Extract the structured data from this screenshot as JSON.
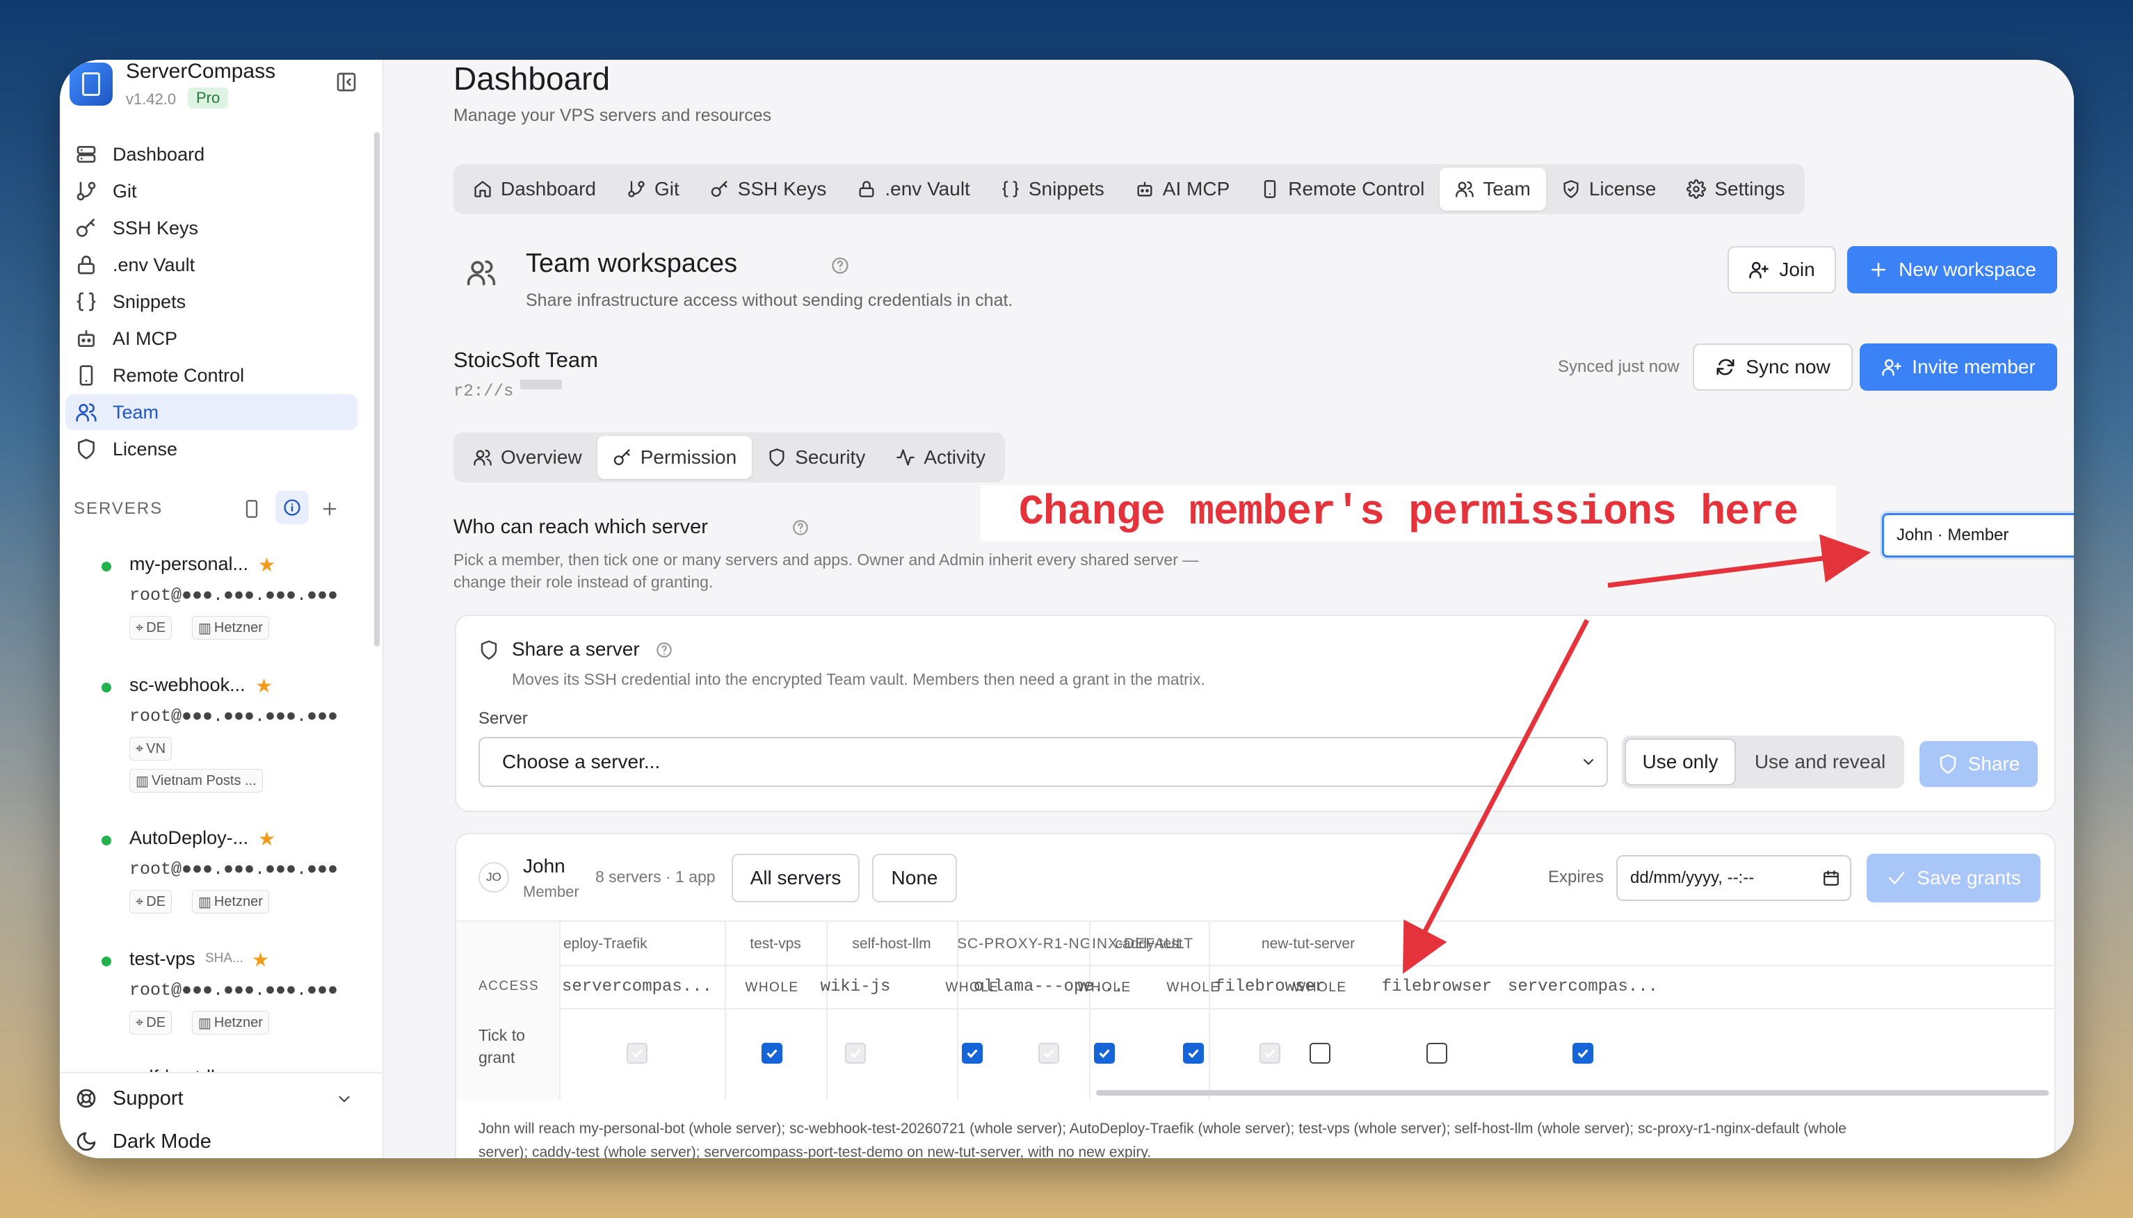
{
  "app": {
    "name": "ServerCompass",
    "version": "v1.42.0",
    "plan": "Pro"
  },
  "sidebar": {
    "nav": [
      {
        "label": "Dashboard",
        "icon": "server-stack-icon"
      },
      {
        "label": "Git",
        "icon": "git-branch-icon"
      },
      {
        "label": "SSH Keys",
        "icon": "key-icon"
      },
      {
        "label": ".env Vault",
        "icon": "lock-icon"
      },
      {
        "label": "Snippets",
        "icon": "braces-icon"
      },
      {
        "label": "AI MCP",
        "icon": "bot-icon"
      },
      {
        "label": "Remote Control",
        "icon": "phone-icon"
      },
      {
        "label": "Team",
        "icon": "users-icon"
      },
      {
        "label": "License",
        "icon": "shield-icon"
      }
    ],
    "servers_heading": "SERVERS",
    "servers": [
      {
        "name": "my-personal...",
        "host": "root@●●●.●●●.●●●.●●●",
        "tags": [
          "DE",
          "Hetzner"
        ]
      },
      {
        "name": "sc-webhook...",
        "host": "root@●●●.●●●.●●●.●●●",
        "tags": [
          "VN",
          "Vietnam Posts ..."
        ]
      },
      {
        "name": "AutoDeploy-...",
        "host": "root@●●●.●●●.●●●.●●●",
        "tags": [
          "DE",
          "Hetzner"
        ]
      },
      {
        "name": "test-vps",
        "badge": "SHA...",
        "host": "root@●●●.●●●.●●●.●●●",
        "tags": [
          "DE",
          "Hetzner"
        ]
      }
    ],
    "partial_server": "self-host-ll...",
    "support_label": "Support",
    "dark_mode_label": "Dark Mode"
  },
  "header": {
    "title": "Dashboard",
    "subtitle": "Manage your VPS servers and resources"
  },
  "tabs": [
    {
      "label": "Dashboard",
      "icon": "home-icon"
    },
    {
      "label": "Git",
      "icon": "git-branch-icon"
    },
    {
      "label": "SSH Keys",
      "icon": "key-icon"
    },
    {
      "label": ".env Vault",
      "icon": "lock-icon"
    },
    {
      "label": "Snippets",
      "icon": "braces-icon"
    },
    {
      "label": "AI MCP",
      "icon": "bot-icon"
    },
    {
      "label": "Remote Control",
      "icon": "phone-icon"
    },
    {
      "label": "Team",
      "icon": "users-icon",
      "active": true
    },
    {
      "label": "License",
      "icon": "shield-icon"
    },
    {
      "label": "Settings",
      "icon": "gear-icon"
    }
  ],
  "workspaces": {
    "title": "Team workspaces",
    "subtitle": "Share infrastructure access without sending credentials in chat.",
    "join_label": "Join",
    "new_label": "New workspace"
  },
  "team": {
    "name": "StoicSoft Team",
    "uri": "r2://s",
    "synced": "Synced just now",
    "sync_label": "Sync now",
    "invite_label": "Invite member"
  },
  "subtabs": [
    {
      "label": "Overview",
      "icon": "users-icon"
    },
    {
      "label": "Permission",
      "icon": "key-icon",
      "active": true
    },
    {
      "label": "Security",
      "icon": "shield-icon"
    },
    {
      "label": "Activity",
      "icon": "activity-icon"
    }
  ],
  "annotation": {
    "text": "Change member's permissions here",
    "color": "#e5333b"
  },
  "permission": {
    "heading": "Who can reach which server",
    "description_1": "Pick a member, then tick one or many servers and apps. Owner and Admin inherit every shared server —",
    "description_2": "change their role instead of granting.",
    "member_select": "John · Member"
  },
  "share": {
    "title": "Share a server",
    "subtitle": "Moves its SSH credential into the encrypted Team vault. Members then need a grant in the matrix.",
    "server_label": "Server",
    "server_placeholder": "Choose a server...",
    "use_only": "Use only",
    "use_reveal": "Use and reveal",
    "share_label": "Share"
  },
  "grants": {
    "avatar": "JO",
    "member_name": "John",
    "member_role": "Member",
    "counts": "8 servers · 1 app",
    "all_label": "All servers",
    "none_label": "None",
    "expires_label": "Expires",
    "expires_placeholder": "dd/mm/yyyy, --:--",
    "save_label": "Save grants",
    "access_label": "ACCESS",
    "row_label_1": "Tick to",
    "row_label_2": "grant",
    "servers": [
      "eploy-Traefik",
      "test-vps",
      "self-host-llm",
      "SC-PROXY-R1-NGINX-DEFAULT",
      "caddy-test",
      "new-tut-server"
    ],
    "columns": [
      {
        "label": "servercompas...",
        "state": "disabled"
      },
      {
        "label": "WHOLE",
        "state": "checked"
      },
      {
        "label": "wiki-js",
        "state": "disabled"
      },
      {
        "label": "WHOLE",
        "state": "checked"
      },
      {
        "label": "ollama---ope...",
        "state": "disabled"
      },
      {
        "label": "WHOLE",
        "state": "checked"
      },
      {
        "label": "WHOLE",
        "state": "checked"
      },
      {
        "label": "filebrowser",
        "state": "disabled"
      },
      {
        "label": "WHOLE",
        "state": "unchecked"
      },
      {
        "label": "filebrowser",
        "state": "unchecked"
      },
      {
        "label": "servercompas...",
        "state": "checked"
      }
    ],
    "summary_1": "John will reach my-personal-bot (whole server); sc-webhook-test-20260721 (whole server); AutoDeploy-Traefik (whole server); test-vps (whole server); self-host-llm (whole server); sc-proxy-r1-nginx-default (whole",
    "summary_2": "server); caddy-test (whole server); servercompass-port-test-demo on new-tut-server, with no new expiry."
  }
}
